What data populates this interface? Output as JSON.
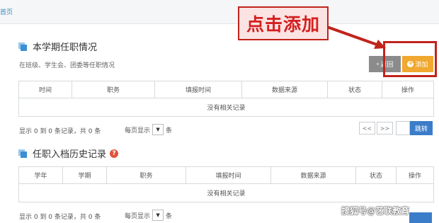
{
  "breadcrumb": "首页",
  "callout": "点击添加",
  "section1": {
    "title": "本学期任职情况",
    "subtitle": "在班级、学生会、团委等任职情况",
    "back_label": "返回",
    "add_label": "添加",
    "columns": [
      "时间",
      "职务",
      "填报时间",
      "数据来源",
      "状态",
      "操作"
    ],
    "empty_text": "没有相关记录",
    "page_info": "显示 0 到 0 条记录，共 0 条",
    "page_size_label": "每页显示",
    "page_size_suffix": "条",
    "prev_label": "<<",
    "next_label": ">>",
    "go_label": "跳转"
  },
  "section2": {
    "title": "任职入档历史记录",
    "columns": [
      "学年",
      "学期",
      "职务",
      "填报时间",
      "数据来源",
      "状态",
      "操作"
    ],
    "empty_text": "没有相关记录",
    "page_info": "显示 0 到 0 条记录，共 0 条",
    "page_size_label": "每页显示",
    "page_size_suffix": "条"
  },
  "watermark": "搜狐号@艺联教育",
  "colors": {
    "accent_blue": "#3b7dc9",
    "add_orange": "#f0a830",
    "back_gray": "#8b8b8b",
    "annotation_red": "#c0241b"
  }
}
